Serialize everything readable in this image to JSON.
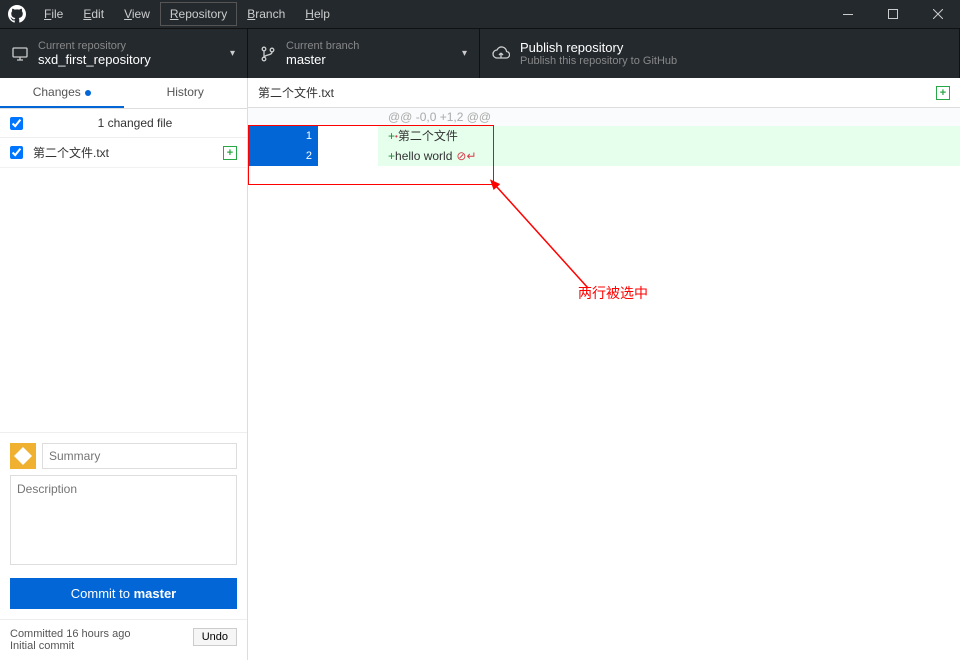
{
  "menu": {
    "file": "File",
    "edit": "Edit",
    "view": "View",
    "repository": "Repository",
    "branch": "Branch",
    "help": "Help"
  },
  "toolbar": {
    "repo_label": "Current repository",
    "repo_value": "sxd_first_repository",
    "branch_label": "Current branch",
    "branch_value": "master",
    "publish_title": "Publish repository",
    "publish_sub": "Publish this repository to GitHub"
  },
  "tabs": {
    "changes": "Changes",
    "history": "History"
  },
  "files": {
    "count_label": "1 changed file",
    "items": [
      {
        "name": "第二个文件.txt"
      }
    ]
  },
  "commit": {
    "summary_placeholder": "Summary",
    "desc_placeholder": "Description",
    "button_prefix": "Commit to ",
    "button_branch": "master"
  },
  "last_commit": {
    "time": "Committed 16 hours ago",
    "msg": "Initial commit",
    "undo": "Undo"
  },
  "diff": {
    "filename": "第二个文件.txt",
    "hunk": "@@ -0,0 +1,2 @@",
    "lines": [
      {
        "new": "1",
        "text": "第二个文件"
      },
      {
        "new": "2",
        "text": "hello world"
      }
    ]
  },
  "annotation": "两行被选中"
}
